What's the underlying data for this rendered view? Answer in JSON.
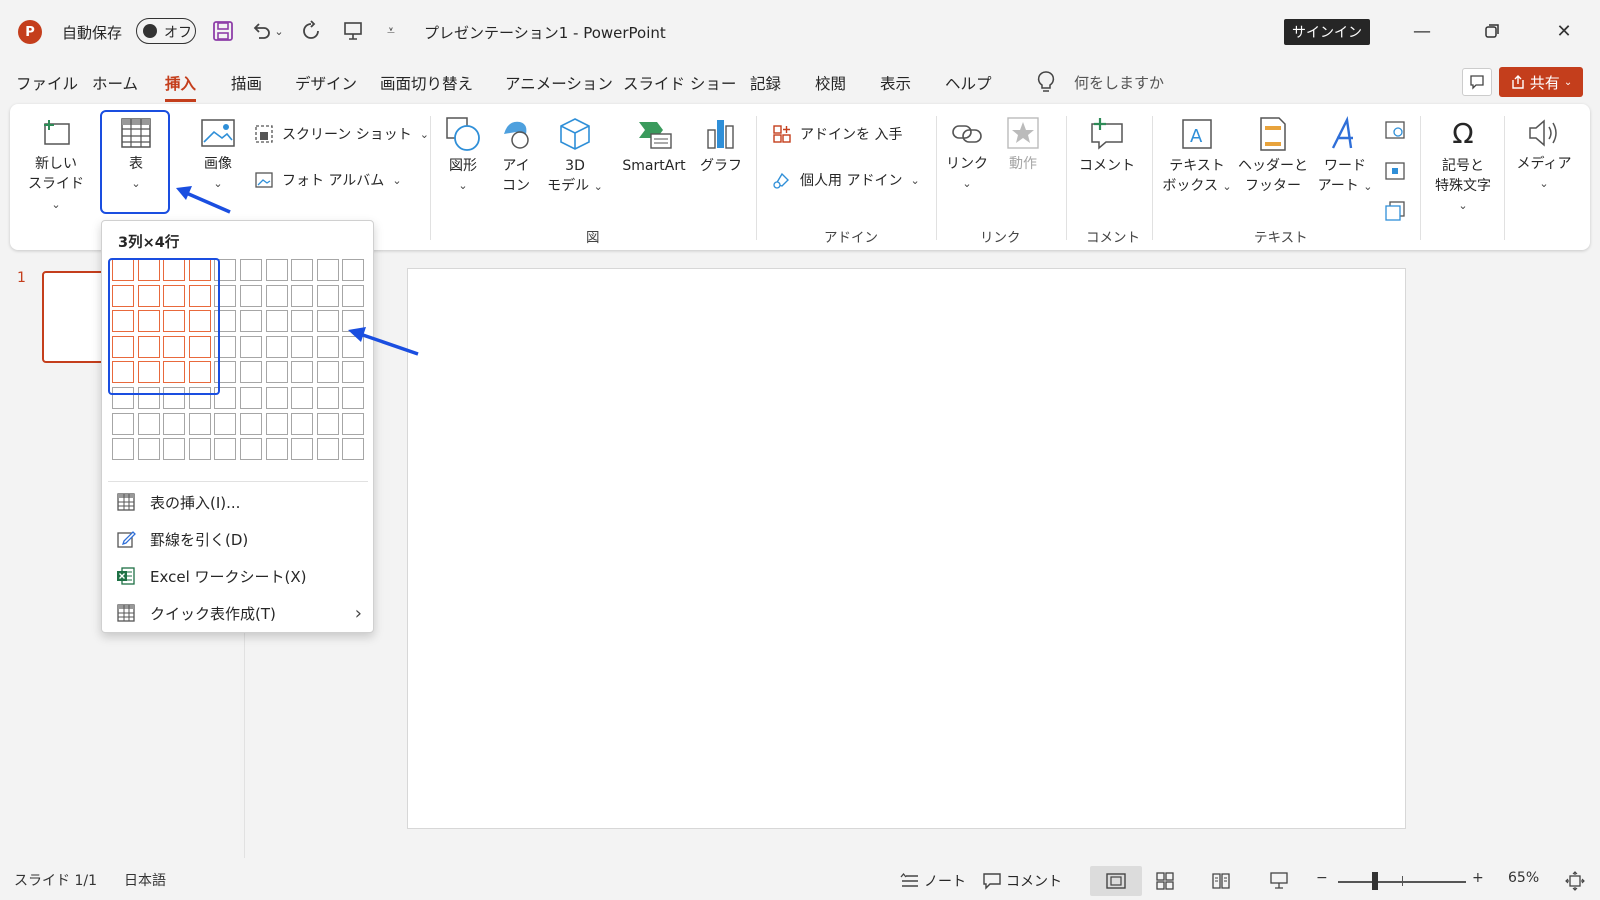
{
  "titlebar": {
    "app_logo": "P",
    "autosave_label": "自動保存",
    "autosave_state": "オフ",
    "document_title": "プレゼンテーション1 - PowerPoint",
    "signin_label": "サインイン",
    "icons": [
      "save-icon",
      "undo-icon",
      "redo-icon",
      "present-icon",
      "customize-icon",
      "minimize-icon",
      "restore-icon",
      "close-icon"
    ]
  },
  "menu": {
    "tabs": [
      "ファイル",
      "ホーム",
      "挿入",
      "描画",
      "デザイン",
      "画面切り替え",
      "アニメーション",
      "スライド ショー",
      "記録",
      "校閲",
      "表示",
      "ヘルプ"
    ],
    "active_tab": "挿入",
    "tell_me": "何をしますか",
    "share_label": "共有"
  },
  "ribbon": {
    "new_slide": [
      "新しい",
      "スライド"
    ],
    "table": "表",
    "image": "画像",
    "screenshot": "スクリーン ショット",
    "photo_album": "フォト アルバム",
    "shapes": "図形",
    "icons": [
      "アイ",
      "コン"
    ],
    "model3d": [
      "3D",
      "モデル"
    ],
    "smartart": "SmartArt",
    "chart": "グラフ",
    "get_addins": "アドインを 入手",
    "my_addins": "個人用 アドイン",
    "link": "リンク",
    "action": "動作",
    "comment": "コメント",
    "textbox": [
      "テキスト",
      "ボックス"
    ],
    "header_footer": [
      "ヘッダーと",
      "フッター"
    ],
    "wordart": [
      "ワード",
      "アート"
    ],
    "symbols": [
      "記号と",
      "特殊文字"
    ],
    "media": "メディア",
    "groups": {
      "figure": "図",
      "addins": "アドイン",
      "links": "リンク",
      "comments": "コメント",
      "text": "テキスト"
    }
  },
  "table_dropdown": {
    "header": "3列×4行",
    "grid_cols": 10,
    "grid_rows": 8,
    "selected_cols": 4,
    "selected_rows": 5,
    "items": [
      {
        "label": "表の挿入(I)...",
        "icon": "table-icon"
      },
      {
        "label": "罫線を引く(D)",
        "icon": "draw-table-icon"
      },
      {
        "label": "Excel ワークシート(X)",
        "icon": "excel-icon"
      },
      {
        "label": "クイック表作成(T)",
        "icon": "quick-table-icon",
        "submenu": true
      }
    ]
  },
  "slides_pane": {
    "slide_number": "1"
  },
  "statusbar": {
    "slide_info": "スライド 1/1",
    "language": "日本語",
    "notes": "ノート",
    "comments": "コメント",
    "zoom": "65%",
    "zoom_minus": "−",
    "zoom_plus": "+"
  },
  "colors": {
    "accent": "#c43e1c",
    "highlight": "#1a4ee0",
    "selected_cell": "#e8693c"
  }
}
